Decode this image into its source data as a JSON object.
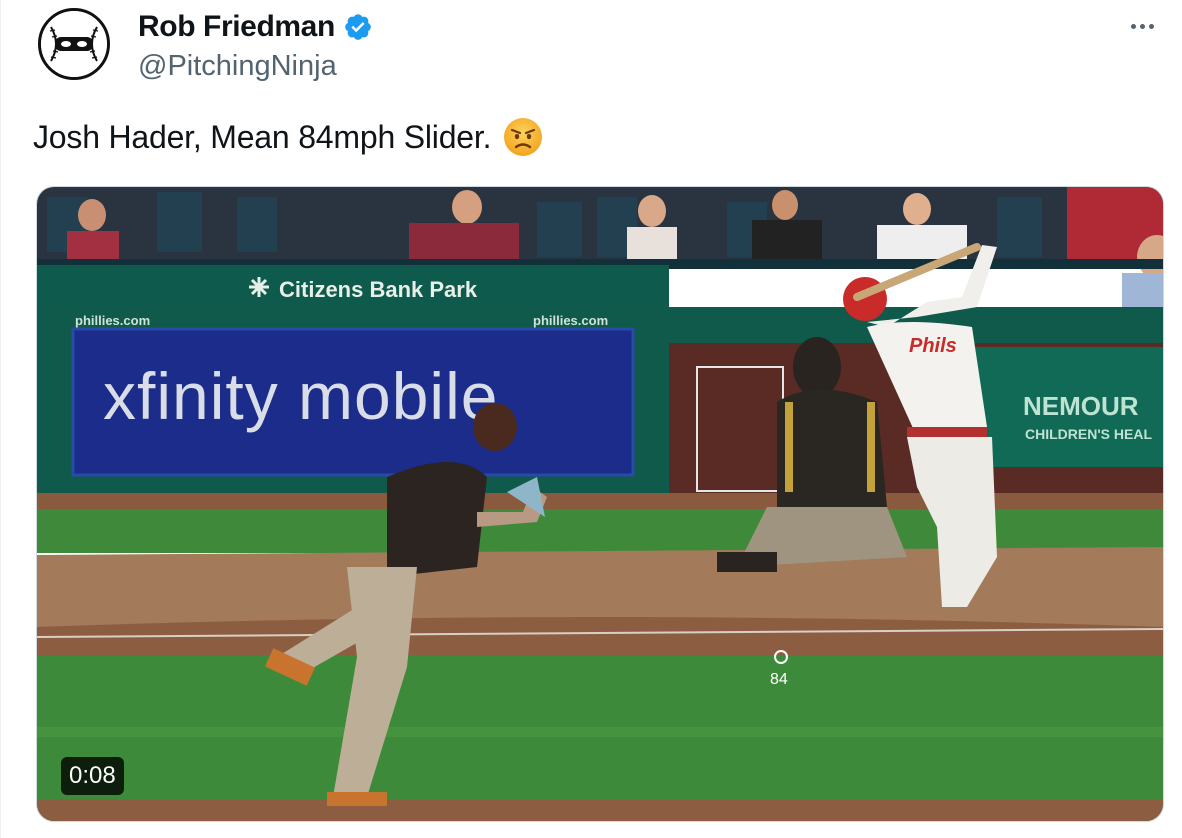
{
  "tweet": {
    "author": {
      "display_name": "Rob Friedman",
      "handle": "@PitchingNinja",
      "verified": true,
      "avatar_icon": "baseball-ninja-avatar"
    },
    "text": "Josh Hader, Mean 84mph Slider.",
    "emoji": "angry-face-emoji",
    "more_icon": "more-dots-icon",
    "verified_color": "#1d9bf0"
  },
  "video": {
    "duration": "0:08",
    "stadium_sign": "Citizens Bank Park",
    "banner_url_left": "phillies.com",
    "banner_url_right": "phillies.com",
    "ad_brand": "xfinity mobile",
    "side_ad_line1": "NEMOUR",
    "side_ad_line2": "CHILDREN'S HEAL",
    "pitch_speed": "84"
  }
}
